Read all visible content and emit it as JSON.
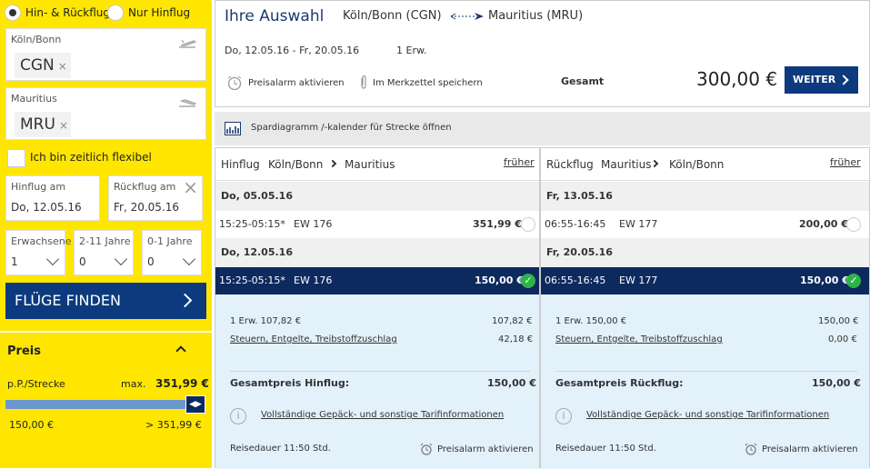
{
  "sidebar": {
    "trip_type": {
      "roundtrip": "Hin- & Rückflug",
      "oneway": "Nur Hinflug"
    },
    "origin": {
      "label": "Köln/Bonn",
      "code": "CGN"
    },
    "destination": {
      "label": "Mauritius",
      "code": "MRU"
    },
    "flexible_label": "Ich bin zeitlich flexibel",
    "departure": {
      "label": "Hinflug am",
      "value": "Do, 12.05.16"
    },
    "return": {
      "label": "Rückflug am",
      "value": "Fr, 20.05.16"
    },
    "adults": {
      "label": "Erwachsene",
      "value": "1"
    },
    "children": {
      "label": "2-11 Jahre",
      "value": "0"
    },
    "infants": {
      "label": "0-1 Jahre",
      "value": "0"
    },
    "find_button": "FLÜGE FINDEN",
    "price_filter": {
      "title": "Preis",
      "per_label": "p.P./Strecke",
      "max_label": "max.",
      "max_value": "351,99 €",
      "min_bound": "150,00 €",
      "max_bound": "> 351,99 €",
      "slider_level": 1.0
    },
    "colors": {
      "yellow": "#ffe600",
      "navy": "#0d3a7e"
    }
  },
  "summary": {
    "title": "Ihre Auswahl",
    "origin": "Köln/Bonn (CGN)",
    "destination": "Mauritius (MRU)",
    "dates": "Do, 12.05.16 - Fr, 20.05.16",
    "pax": "1 Erw.",
    "price_alert": "Preisalarm aktivieren",
    "bookmark": "Im Merkzettel speichern",
    "total_label": "Gesamt",
    "total_value": "300,00 €",
    "next_button": "WEITER"
  },
  "spar_bar": "Spardiagramm /-kalender für Strecke öffnen",
  "outbound": {
    "type_label": "Hinflug",
    "from": "Köln/Bonn",
    "to": "Mauritius",
    "earlier": "früher",
    "days": [
      {
        "date": "Do, 05.05.16",
        "time": "15:25-05:15*",
        "flight": "EW 176",
        "price": "351,99 €"
      },
      {
        "date": "Do, 12.05.16",
        "time": "15:25-05:15*",
        "flight": "EW 176",
        "price": "150,00 €"
      }
    ],
    "detail": {
      "line1_label": "1 Erw. 107,82 €",
      "line1_value": "107,82 €",
      "line2_label": "Steuern, Entgelte, Treibstoffzuschlag",
      "line2_value": "42,18 €",
      "total_label": "Gesamtpreis Hinflug:",
      "total_value": "150,00 €",
      "info_link": "Vollständige Gepäck- und sonstige Tarifinformationen",
      "duration": "Reisedauer 11:50  Std.",
      "alert": "Preisalarm aktivieren"
    }
  },
  "inbound": {
    "type_label": "Rückflug",
    "from": "Mauritius",
    "to": "Köln/Bonn",
    "earlier": "früher",
    "days": [
      {
        "date": "Fr, 13.05.16",
        "time": "06:55-16:45",
        "flight": "EW 177",
        "price": "200,00 €"
      },
      {
        "date": "Fr, 20.05.16",
        "time": "06:55-16:45",
        "flight": "EW 177",
        "price": "150,00 €"
      }
    ],
    "detail": {
      "line1_label": "1 Erw. 150,00 €",
      "line1_value": "150,00 €",
      "line2_label": "Steuern, Entgelte, Treibstoffzuschlag",
      "line2_value": "0,00 €",
      "total_label": "Gesamtpreis Rückflug:",
      "total_value": "150,00 €",
      "info_link": "Vollständige Gepäck- und sonstige Tarifinformationen",
      "duration": "Reisedauer 11:50  Std.",
      "alert": "Preisalarm aktivieren"
    }
  }
}
